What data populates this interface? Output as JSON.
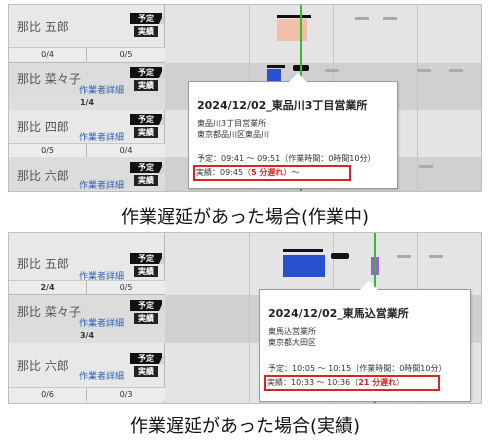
{
  "badges": {
    "plan": "予定",
    "actual": "実績"
  },
  "detail_link": "作業者詳細",
  "panel1": {
    "workers": [
      {
        "name": "那比 五郎",
        "counts": [
          "0/4",
          "0/5"
        ]
      },
      {
        "name": "那比 菜々子",
        "counts": [
          "1/4"
        ]
      },
      {
        "name": "那比 四郎",
        "counts": [
          "0/5",
          "0/4"
        ]
      },
      {
        "name": "那比 六郎"
      }
    ],
    "popup": {
      "title": "2024/12/02_東品川3丁目営業所",
      "name": "東品川3丁目営業所",
      "address": "東京都品川区東品川",
      "plan": "予定：09:41 ～ 09:51（作業時間：0時間10分）",
      "actual_prefix": "実績：09:45（",
      "actual_delay": "5 分遅れ",
      "actual_suffix": "）～"
    },
    "caption": "作業遅延があった場合(作業中)"
  },
  "panel2": {
    "workers": [
      {
        "name": "那比 五郎",
        "counts": [
          "2/4",
          "0/5"
        ]
      },
      {
        "name": "那比 菜々子",
        "counts": [
          "3/4"
        ]
      },
      {
        "name": "那比 六郎",
        "counts": [
          "0/6",
          "0/3"
        ]
      }
    ],
    "popup": {
      "title": "2024/12/02_東馬込営業所",
      "name": "東馬込営業所",
      "address": "東京都大田区",
      "plan": "予定：10:05 ～ 10:15（作業時間：0時間10分）",
      "actual_prefix": "実績：10:33 ～ 10:36（",
      "actual_delay": "21 分遅れ",
      "actual_suffix": "）"
    },
    "caption": "作業遅延があった場合(実績)"
  },
  "colors": {
    "delay": "#dd2222",
    "now_line": "#33bb33",
    "plan_block": "#f0c0a8",
    "actual_block": "#2a4fd0",
    "marker": "#9a5fd0"
  }
}
